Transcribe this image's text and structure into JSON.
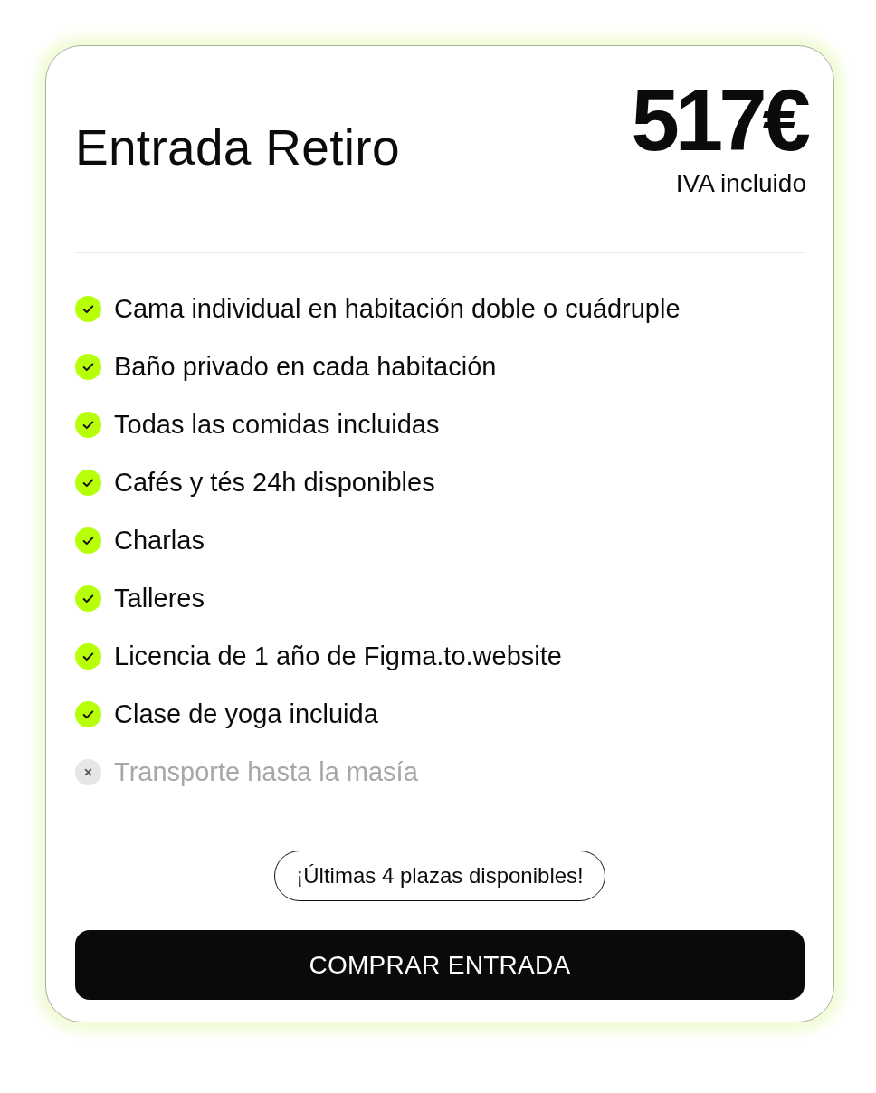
{
  "card": {
    "title": "Entrada Retiro",
    "price": "517€",
    "price_note": "IVA incluido",
    "features": [
      {
        "label": "Cama individual en habitación doble o cuádruple",
        "included": true
      },
      {
        "label": "Baño privado en cada habitación",
        "included": true
      },
      {
        "label": "Todas las comidas incluidas",
        "included": true
      },
      {
        "label": "Cafés y tés 24h disponibles",
        "included": true
      },
      {
        "label": "Charlas",
        "included": true
      },
      {
        "label": "Talleres",
        "included": true
      },
      {
        "label": "Licencia de 1 año de Figma.to.website",
        "included": true
      },
      {
        "label": "Clase de yoga incluida",
        "included": true
      },
      {
        "label": "Transporte hasta la masía",
        "included": false
      }
    ],
    "availability": "¡Últimas 4 plazas disponibles!",
    "buy_button": "COMPRAR ENTRADA"
  }
}
